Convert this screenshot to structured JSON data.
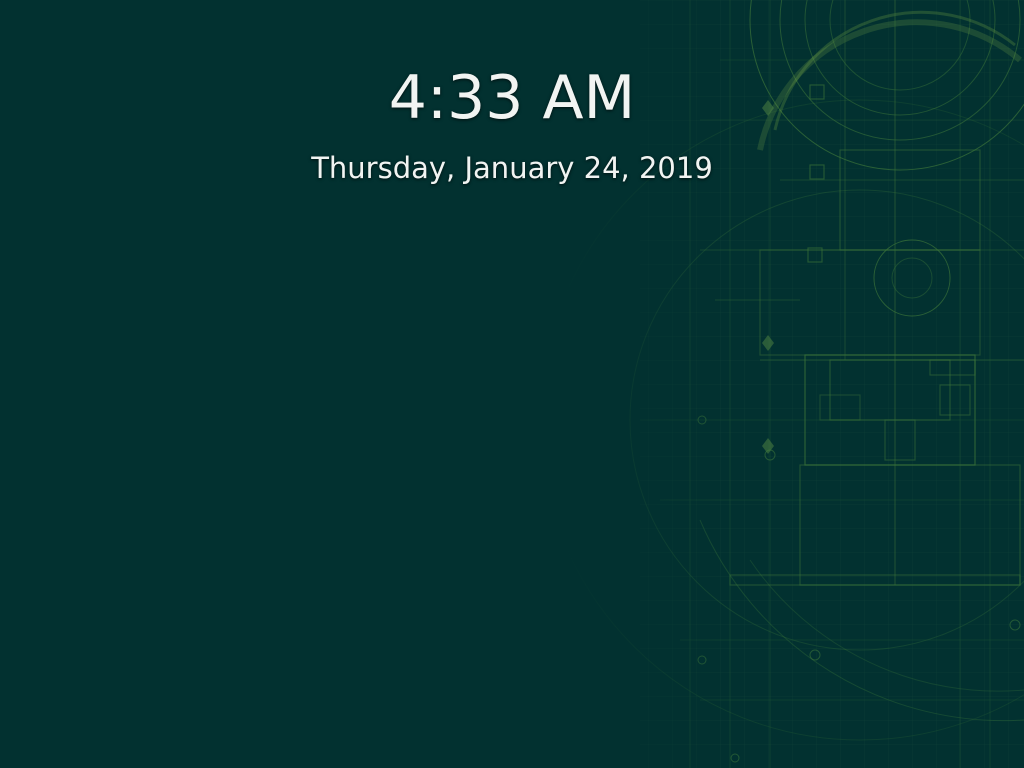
{
  "lock_screen": {
    "time": "4:33 AM",
    "date": "Thursday, January 24, 2019"
  },
  "wallpaper": {
    "name": "blueprint-architectural-plan",
    "background_color": "#023130",
    "line_color": "#4f8a3c",
    "highlight_color": "#8fbf4a"
  }
}
